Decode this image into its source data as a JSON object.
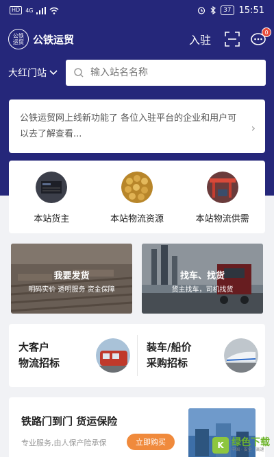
{
  "status_bar": {
    "network": "4G",
    "hd": "HD",
    "battery": "37",
    "time": "15:51"
  },
  "header": {
    "logo_text": "公铁运贸",
    "title": "公铁运贸",
    "join_label": "入驻",
    "message_badge": "0"
  },
  "station": {
    "selected": "大红门站"
  },
  "search": {
    "placeholder": "输入站名名称"
  },
  "notice": {
    "text": "公铁运贸网上线新功能了 各位入驻平台的企业和用户可以去了解查看..."
  },
  "categories": [
    {
      "label": "本站货主"
    },
    {
      "label": "本站物流资源"
    },
    {
      "label": "本站物流供需"
    }
  ],
  "banners": [
    {
      "title": "我要发货",
      "subtitle": "明码实价 透明服务 资金保障"
    },
    {
      "title": "找车、找货",
      "subtitle": "货主找车，司机找货"
    }
  ],
  "tenders": [
    {
      "line1": "大客户",
      "line2": "物流招标"
    },
    {
      "line1": "装车/船价",
      "line2": "采购招标"
    }
  ],
  "insurance": {
    "title": "铁路门到门 货运保险",
    "subtitle": "专业服务,由人保产险承保",
    "button": "立即购买"
  },
  "watermark": {
    "logo": "K",
    "text": "绿色下载",
    "sub": "中国 · 安全 · 高速"
  },
  "colors": {
    "header_bg": "#25277a",
    "accent": "#f08a3c",
    "badge": "#e74c3c"
  }
}
